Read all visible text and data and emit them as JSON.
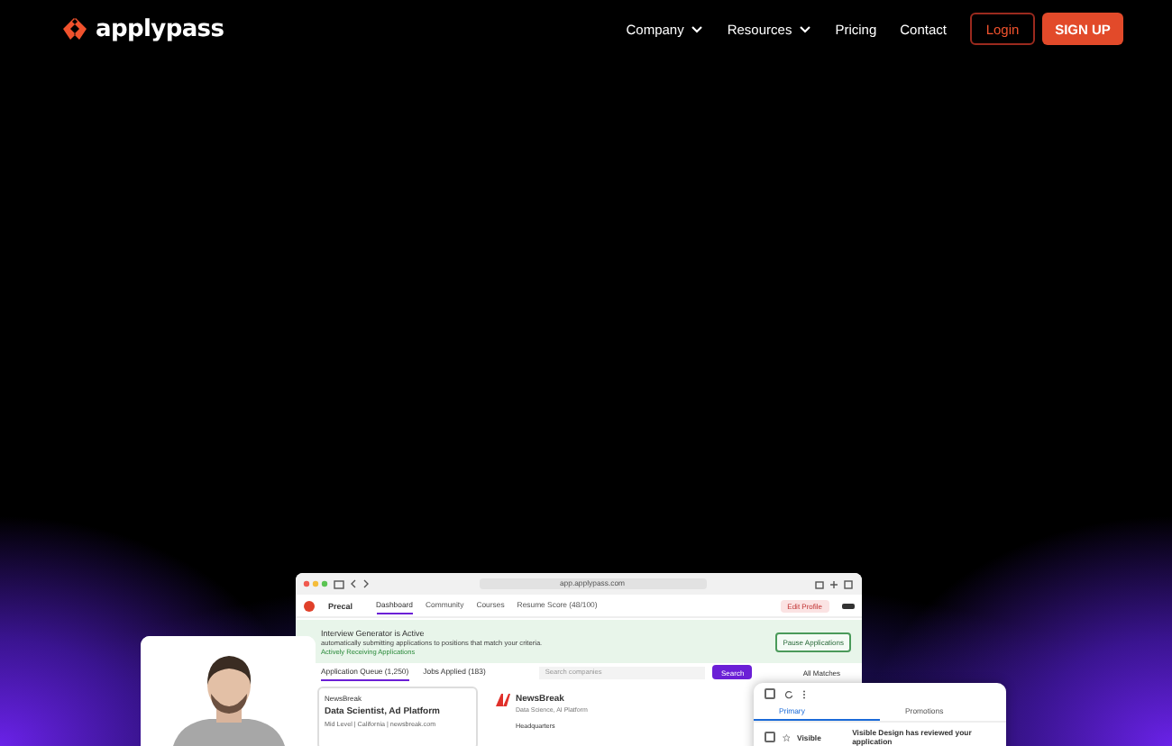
{
  "nav": {
    "brand": "applypass",
    "links": [
      {
        "label": "Company",
        "dropdown": true
      },
      {
        "label": "Resources",
        "dropdown": true
      },
      {
        "label": "Pricing",
        "dropdown": false
      },
      {
        "label": "Contact",
        "dropdown": false
      }
    ],
    "login": "Login",
    "signup": "SIGN UP"
  },
  "app_window": {
    "url": "app.applypass.com",
    "brand": "Precal",
    "tabs": [
      {
        "label": "Dashboard",
        "selected": true
      },
      {
        "label": "Community",
        "selected": false
      },
      {
        "label": "Courses",
        "selected": false
      },
      {
        "label": "Resume Score (48/100)",
        "selected": false
      }
    ],
    "edit_profile": "Edit Profile",
    "banner": {
      "title": "Interview Generator is Active",
      "lines": [
        "automatically submitting applications to positions that match your criteria.",
        "Actively Receiving Applications"
      ],
      "button": "Pause Applications"
    },
    "queue_tabs": [
      {
        "label": "Application Queue (1,250)",
        "selected": true
      },
      {
        "label": "Jobs Applied (183)",
        "selected": false
      }
    ],
    "search": {
      "placeholder": "Search companies",
      "button": "Search"
    },
    "filter": "All Matches",
    "job_card": {
      "company": "NewsBreak",
      "title": "Data Scientist, Ad Platform",
      "meta": "Mid Level | California | newsbreak.com"
    },
    "detail": {
      "company": "NewsBreak",
      "subtitle": "Data Science, AI Platform",
      "section": "Headquarters"
    }
  },
  "mail_window": {
    "tabs": [
      {
        "label": "Primary",
        "selected": true
      },
      {
        "label": "Promotions",
        "selected": false
      }
    ],
    "rows": [
      {
        "sender": "Visible",
        "subject": "Visible Design has reviewed your application"
      }
    ]
  }
}
